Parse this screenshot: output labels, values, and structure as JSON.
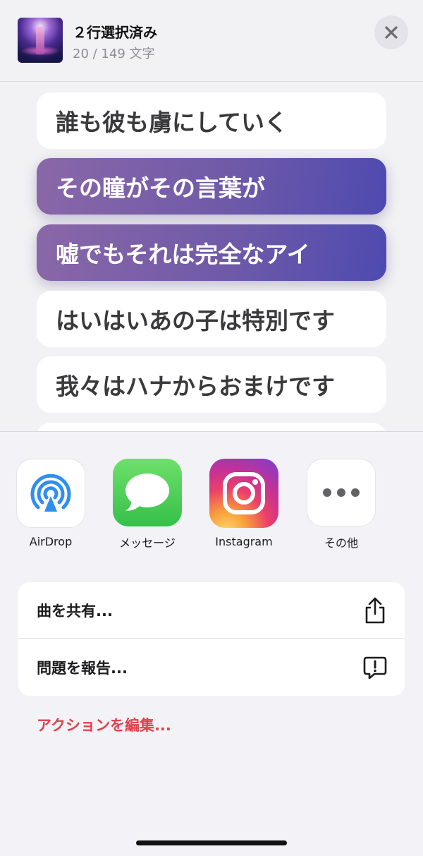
{
  "header": {
    "title": "２行選択済み",
    "subtitle": "20 / 149 文字",
    "artwork_icon": "album-artwork-icon",
    "close_icon": "close-icon"
  },
  "lyrics": [
    {
      "text": "誰も彼も虜にしていく",
      "selected": false
    },
    {
      "text": "その瞳がその言葉が",
      "selected": true
    },
    {
      "text": "嘘でもそれは完全なアイ",
      "selected": true
    },
    {
      "text": "はいはいあの子は特別です",
      "selected": false
    },
    {
      "text": "我々はハナからおまけです",
      "selected": false
    },
    {
      "text": "",
      "selected": false
    }
  ],
  "share_apps": [
    {
      "label": "AirDrop",
      "icon": "airdrop-icon"
    },
    {
      "label": "メッセージ",
      "icon": "messages-icon"
    },
    {
      "label": "Instagram",
      "icon": "instagram-icon"
    },
    {
      "label": "その他",
      "icon": "more-icon"
    }
  ],
  "actions": [
    {
      "label": "曲を共有...",
      "icon": "share-icon"
    },
    {
      "label": "問題を報告...",
      "icon": "report-problem-icon"
    }
  ],
  "edit_actions_label": "アクションを編集...",
  "colors": {
    "accent_red": "#e0404a",
    "selected_gradient_start": "#8a67a8",
    "selected_gradient_end": "#4e4ab0",
    "background": "#f2f2f4"
  }
}
